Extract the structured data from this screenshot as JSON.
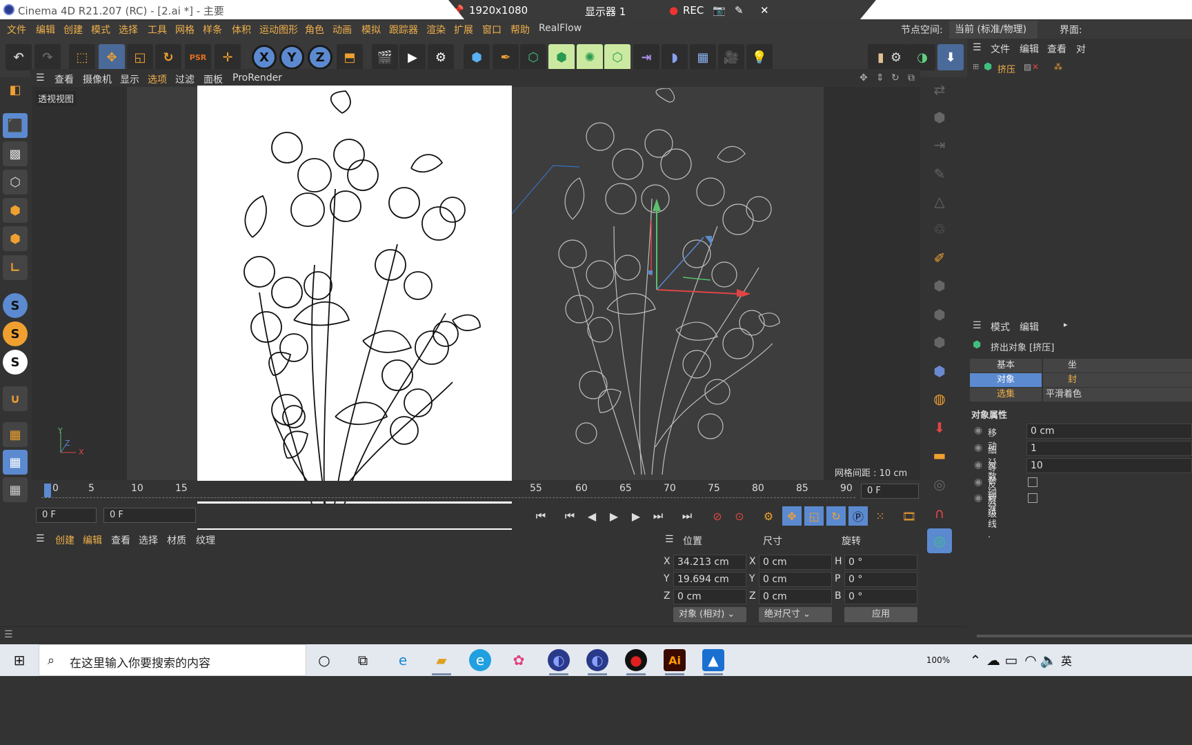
{
  "titlebar": {
    "title": "Cinema 4D R21.207 (RC) - [2.ai *] - 主要",
    "resolution": "1920x1080",
    "display": "显示器 1",
    "rec": "REC"
  },
  "menu": {
    "items": [
      "文件",
      "编辑",
      "创建",
      "模式",
      "选择",
      "工具",
      "网格",
      "样条",
      "体积",
      "运动图形",
      "角色",
      "动画",
      "模拟",
      "跟踪器",
      "渲染",
      "扩展",
      "窗口",
      "帮助",
      "RealFlow"
    ],
    "node_space_label": "节点空间:",
    "node_space_value": "当前 (标准/物理)",
    "layout_label": "界面:"
  },
  "viewport": {
    "menu": [
      "查看",
      "摄像机",
      "显示",
      "选项",
      "过滤",
      "面板",
      "ProRender"
    ],
    "label": "透视视图",
    "grid_spacing": "网格间距 : 10 cm",
    "axis_x": "X",
    "axis_y": "Y",
    "axis_z": "Z"
  },
  "timeline": {
    "ticks": [
      "0",
      "5",
      "10",
      "15",
      "55",
      "60",
      "65",
      "70",
      "75",
      "80",
      "85",
      "90"
    ],
    "end_field": "0 F",
    "start_field": "0 F",
    "current_field": "0 F"
  },
  "material": {
    "menu": [
      "创建",
      "编辑",
      "查看",
      "选择",
      "材质",
      "纹理"
    ]
  },
  "coords": {
    "headers": [
      "位置",
      "尺寸",
      "旋转"
    ],
    "rows": [
      {
        "pos_label": "X",
        "pos": "34.213 cm",
        "size_label": "X",
        "size": "0 cm",
        "rot_label": "H",
        "rot": "0 °"
      },
      {
        "pos_label": "Y",
        "pos": "19.694 cm",
        "size_label": "Y",
        "size": "0 cm",
        "rot_label": "P",
        "rot": "0 °"
      },
      {
        "pos_label": "Z",
        "pos": "0 cm",
        "size_label": "Z",
        "size": "0 cm",
        "rot_label": "B",
        "rot": "0 °"
      }
    ],
    "mode_select": "对象 (相对)",
    "size_select": "绝对尺寸",
    "apply": "应用"
  },
  "objmgr": {
    "menu": [
      "文件",
      "编辑",
      "查看",
      "对"
    ],
    "object_name": "挤压"
  },
  "attr": {
    "menu": [
      "模式",
      "编辑"
    ],
    "title": "挤出对象 [挤压]",
    "tabs_row1": [
      "基本",
      "坐"
    ],
    "tabs_row2": [
      "对象",
      "封"
    ],
    "tabs_row3": [
      "选集",
      "平滑着色"
    ],
    "section": "对象属性",
    "props": [
      {
        "label": "移动 . . .",
        "value": "0 cm"
      },
      {
        "label": "细分数 . .",
        "value": "1"
      },
      {
        "label": "等参细分",
        "value": "10"
      },
      {
        "label": "反转法线",
        "value": ""
      },
      {
        "label": "层级 . . .",
        "value": ""
      }
    ]
  },
  "taskbar": {
    "search_placeholder": "在这里输入你要搜索的内容",
    "battery": "100%",
    "ime": "英"
  }
}
